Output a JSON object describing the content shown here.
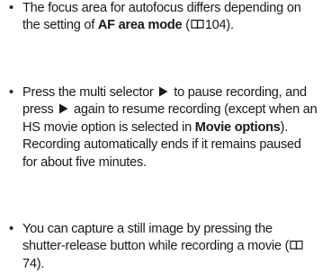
{
  "items": [
    {
      "t1": "The focus area for autofocus differs depending on the setting of ",
      "b1": "AF area mode",
      "t2": " (",
      "ref": "104",
      "t3": ")."
    },
    {
      "t1": "Press the multi selector",
      "t2": "to pause recording, and press",
      "t3": "again to resume recording (except when an HS movie option is selected in ",
      "b1": "Movie options",
      "t4": "). Recording automatically ends if it remains paused for about five minutes."
    },
    {
      "t1": "You can capture a still image by pressing the shutter-release button while recording a movie (",
      "ref": "74",
      "t2": ")."
    }
  ],
  "bullet_glyph": "•",
  "icons": {
    "reference": "book-reference-icon",
    "selector_right": "multi-selector-right-icon"
  }
}
